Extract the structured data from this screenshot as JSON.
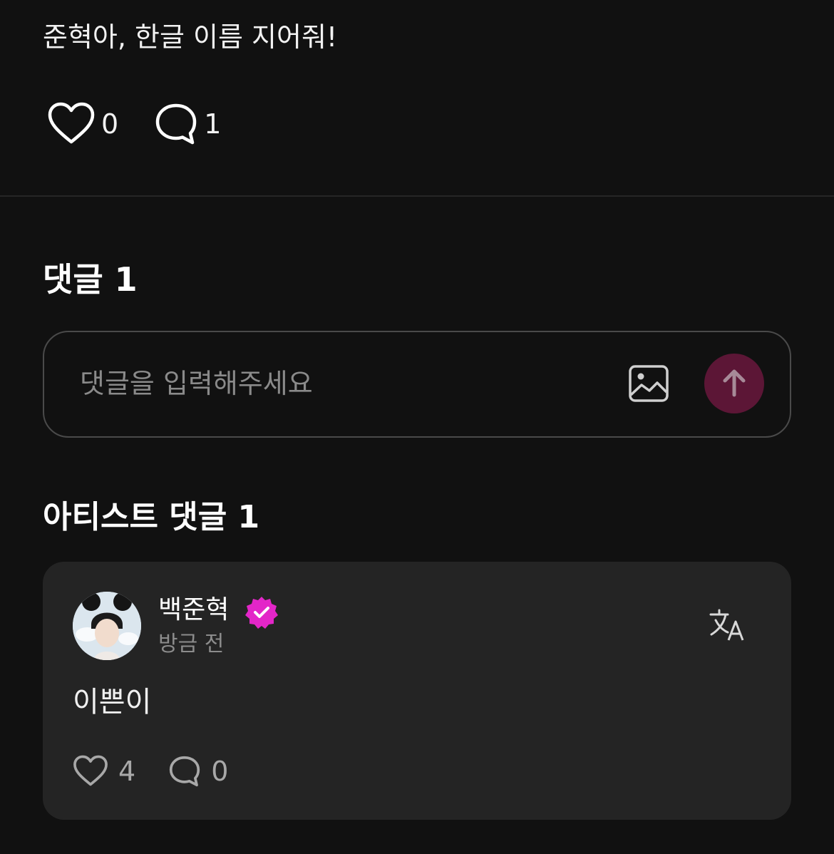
{
  "post": {
    "text": "준혁아, 한글 이름 지어줘!",
    "like_count": "0",
    "comment_count": "1"
  },
  "comments": {
    "title": "댓글 1",
    "input_placeholder": "댓글을 입력해주세요"
  },
  "artist_comments": {
    "title": "아티스트 댓글 1",
    "items": [
      {
        "author": "백준혁",
        "time": "방금 전",
        "text": "이쁜이",
        "like_count": "4",
        "comment_count": "0"
      }
    ]
  },
  "colors": {
    "background": "#111111",
    "card": "#242424",
    "send_button": "#5c1636",
    "verified": "#e326c8"
  },
  "icons": [
    "heart-icon",
    "comment-bubble-icon",
    "image-icon",
    "arrow-up-icon",
    "verified-badge-icon",
    "translate-icon"
  ]
}
